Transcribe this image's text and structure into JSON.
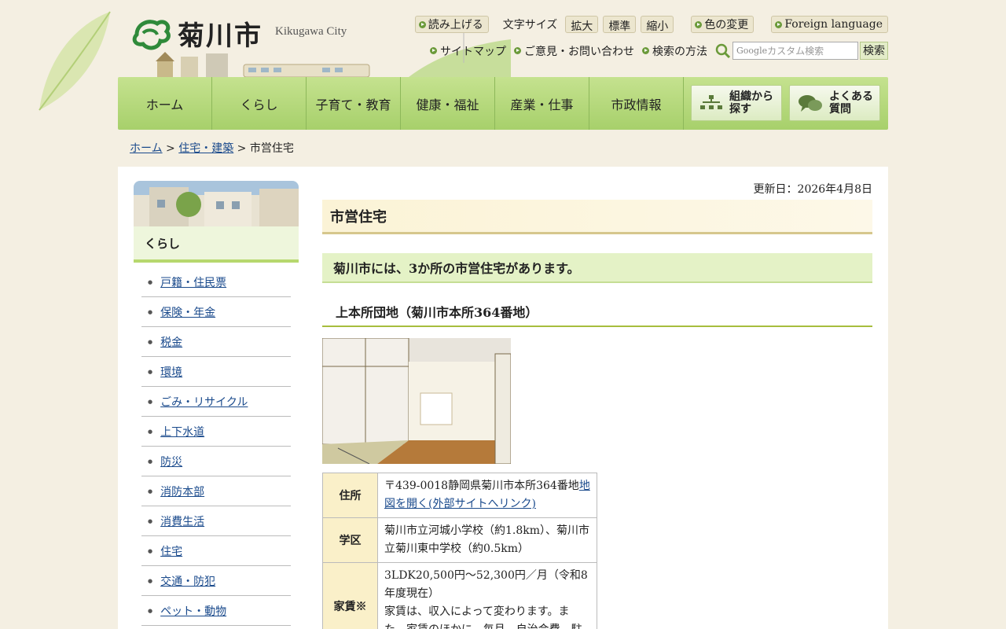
{
  "header": {
    "logo_text": "菊川市",
    "logo_en": "Kikugawa City",
    "read_aloud": "読み上げる",
    "font_size_label": "文字サイズ",
    "font_size_options": [
      "拡大",
      "標準",
      "縮小"
    ],
    "color_change": "色の変更",
    "foreign_language": "Foreign language",
    "sitemap": "サイトマップ",
    "feedback": "ご意見・お問い合わせ",
    "search_help": "検索の方法",
    "search_placeholder": "カスタム検索",
    "search_brand": "Google",
    "search_button": "検索"
  },
  "nav": {
    "items": [
      "ホーム",
      "くらし",
      "子育て・教育",
      "健康・福祉",
      "産業・仕事",
      "市政情報"
    ],
    "org_search": [
      "組織から",
      "探す"
    ],
    "faq": [
      "よくある",
      "質問"
    ]
  },
  "breadcrumb": {
    "home": "ホーム",
    "sep": " > ",
    "parent": "住宅・建築",
    "current": "市営住宅"
  },
  "sidebar": {
    "heading": "くらし",
    "items": [
      "戸籍・住民票",
      "保険・年金",
      "税金",
      "環境",
      "ごみ・リサイクル",
      "上下水道",
      "防災",
      "消防本部",
      "消費生活",
      "住宅",
      "交通・防犯",
      "ペット・動物"
    ]
  },
  "main": {
    "updated": "更新日：2026年4月8日",
    "title": "市営住宅",
    "h2": "菊川市には、3か所の市営住宅があります。",
    "h3": "上本所団地（菊川市本所364番地）",
    "table": {
      "address_label": "住所",
      "address_text": "〒439-0018静岡県菊川市本所364番地",
      "address_link": "地図を開く(外部サイトへリンク)",
      "school_label": "学区",
      "school_text": "菊川市立河城小学校（約1.8km）、菊川市立菊川東中学校（約0.5km）",
      "rent_label": "家賃※",
      "rent_text": "3LDK20,500円～52,300円／月（令和8年度現在）",
      "rent_note": "家賃は、収入によって変わります。また、家賃のほかに、毎月、自治会費、駐"
    }
  },
  "colors": {
    "nav_green": "#a7d06b",
    "title_bg": "#fbf3d6",
    "h2_bg": "#e4f2c6",
    "th_bg": "#faf0c9",
    "link": "#1a4a8c"
  }
}
